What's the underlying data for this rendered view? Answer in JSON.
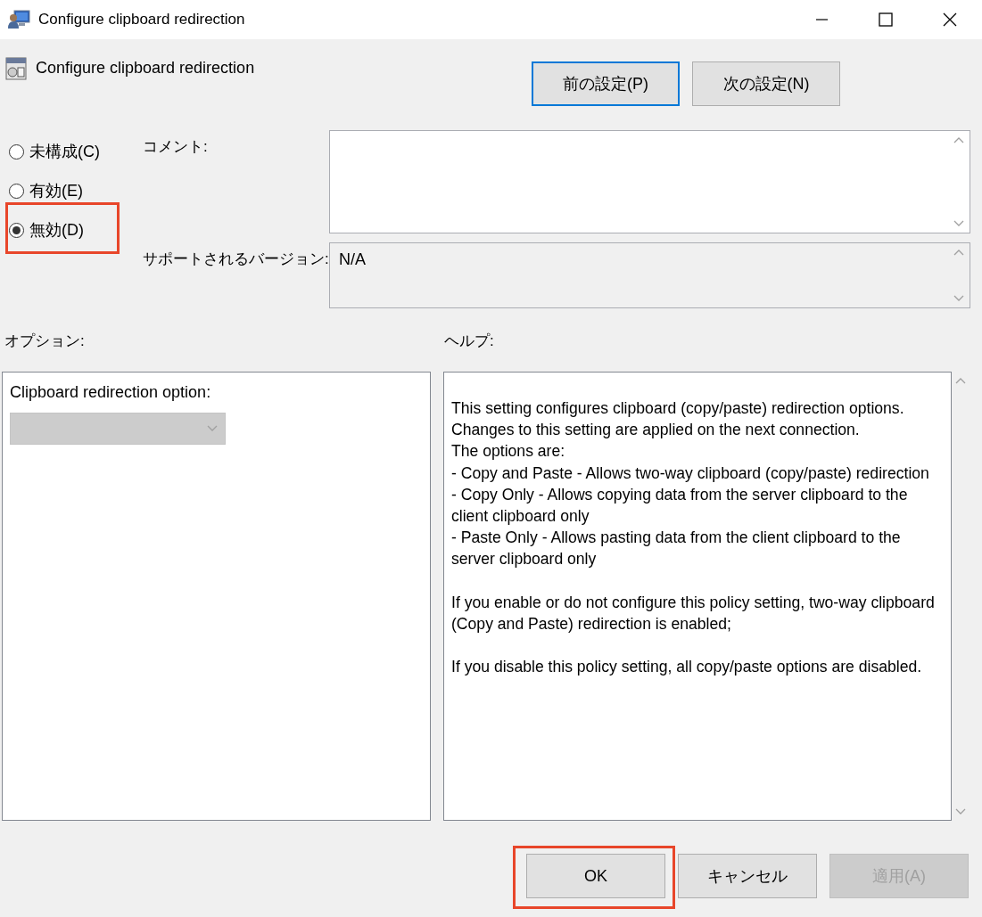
{
  "window": {
    "title": "Configure clipboard redirection"
  },
  "policy": {
    "title": "Configure clipboard redirection"
  },
  "nav_buttons": [
    {
      "label": "前の設定(P)",
      "selected": true
    },
    {
      "label": "次の設定(N)",
      "selected": false
    }
  ],
  "states": [
    {
      "label": "未構成(C)",
      "selected": false,
      "highlighted": false
    },
    {
      "label": "有効(E)",
      "selected": false,
      "highlighted": false
    },
    {
      "label": "無効(D)",
      "selected": true,
      "highlighted": true
    }
  ],
  "comment": {
    "label": "コメント:"
  },
  "supported": {
    "label": "サポートされるバージョン:",
    "value": "N/A"
  },
  "options": {
    "label": "オプション:",
    "field_label": "Clipboard redirection option:",
    "dropdown_disabled": true
  },
  "help": {
    "label": "ヘルプ:",
    "text": "This setting configures clipboard (copy/paste) redirection options. Changes to this setting are applied on the next connection.\nThe options are:\n- Copy and Paste - Allows two-way clipboard (copy/paste) redirection\n- Copy Only - Allows copying data from the server clipboard to the client clipboard only\n- Paste Only - Allows pasting data from the client clipboard to the server clipboard only\n\nIf you enable or do not configure this policy setting, two-way clipboard (Copy and Paste) redirection is enabled;\n\nIf you disable this policy setting, all copy/paste options are disabled."
  },
  "buttons": [
    {
      "label": "OK",
      "disabled": false,
      "highlighted": true
    },
    {
      "label": "キャンセル",
      "disabled": false,
      "highlighted": false
    },
    {
      "label": "適用(A)",
      "disabled": true,
      "highlighted": false
    }
  ]
}
